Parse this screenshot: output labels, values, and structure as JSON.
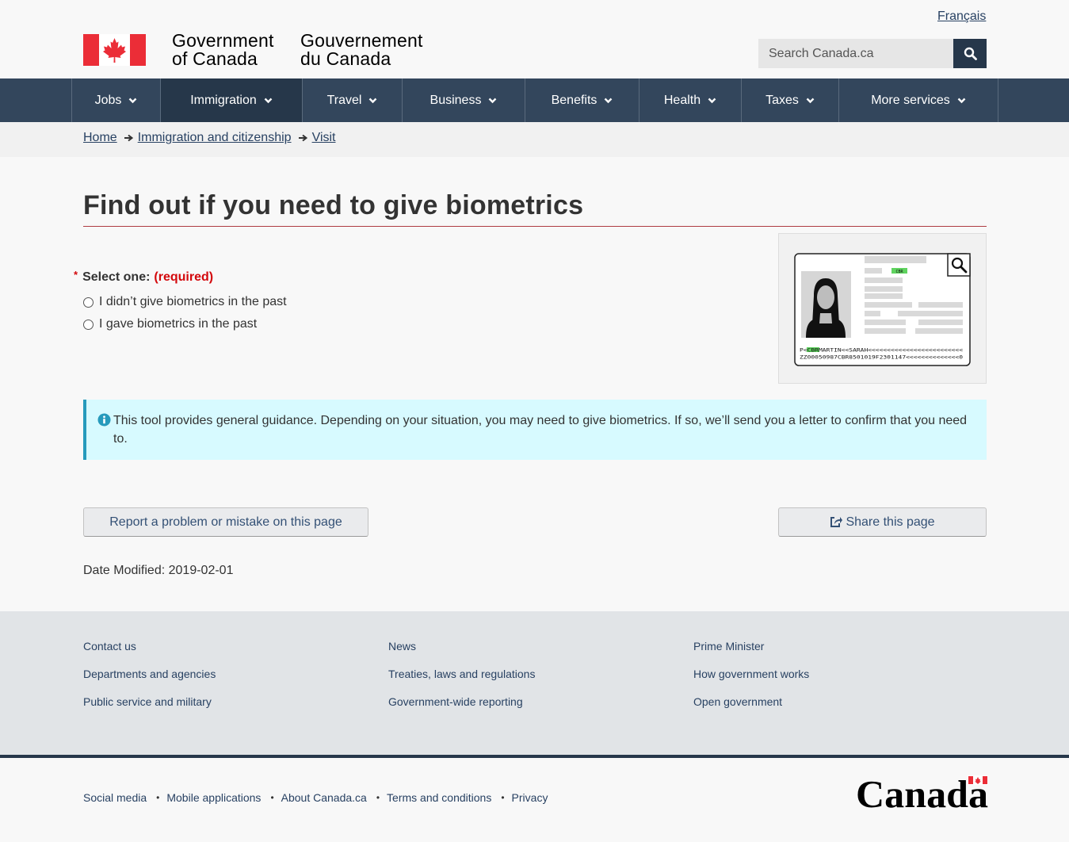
{
  "header": {
    "language_link": "Français",
    "signature_en_line1": "Government",
    "signature_en_line2": "of Canada",
    "signature_fr_line1": "Gouvernement",
    "signature_fr_line2": "du Canada",
    "search_placeholder": "Search Canada.ca",
    "colors": {
      "brand_dark": "#26374a",
      "menu": "#33465c",
      "flag_red": "#eb2d37"
    }
  },
  "menu": {
    "items": [
      {
        "label": "Jobs"
      },
      {
        "label": "Immigration"
      },
      {
        "label": "Travel"
      },
      {
        "label": "Business"
      },
      {
        "label": "Benefits"
      },
      {
        "label": "Health"
      },
      {
        "label": "Taxes"
      },
      {
        "label": "More services"
      }
    ],
    "active": "Immigration"
  },
  "breadcrumb": {
    "items": [
      {
        "label": "Home"
      },
      {
        "label": "Immigration and citizenship"
      },
      {
        "label": "Visit"
      }
    ]
  },
  "page": {
    "title": "Find out if you need to give biometrics",
    "form": {
      "required_marker": "*",
      "legend": "Select one:",
      "required_text": "(required)",
      "options": [
        {
          "label": "I didn’t give biometrics in the past",
          "checked": false
        },
        {
          "label": "I gave biometrics in the past",
          "checked": false
        }
      ]
    },
    "figure": {
      "icon": "passport-illustration",
      "country_code": "CBR",
      "mrz_line1": "P<CBRMARTIN<<SARAH<<<<<<<<<<<<<<<<<<<<<<<<<",
      "mrz_line2": "ZZ00050987CBR8501019F2301147<<<<<<<<<<<<<<0"
    },
    "alert": {
      "icon": "info-icon",
      "text": "This tool provides general guidance. Depending on your situation, you may need to give biometrics. If so, we’ll send you a letter to confirm that you need to."
    },
    "report_button": "Report a problem or mistake on this page",
    "share_button": "Share this page",
    "date_modified_label": "Date Modified:",
    "date_modified_value": "2019-02-01"
  },
  "footer": {
    "columns": [
      [
        "Contact us",
        "Departments and agencies",
        "Public service and military"
      ],
      [
        "News",
        "Treaties, laws and regulations",
        "Government-wide reporting"
      ],
      [
        "Prime Minister",
        "How government works",
        "Open government"
      ]
    ],
    "bottom_links": [
      "Social media",
      "Mobile applications",
      "About Canada.ca",
      "Terms and conditions",
      "Privacy"
    ],
    "wordmark": "Canada"
  }
}
